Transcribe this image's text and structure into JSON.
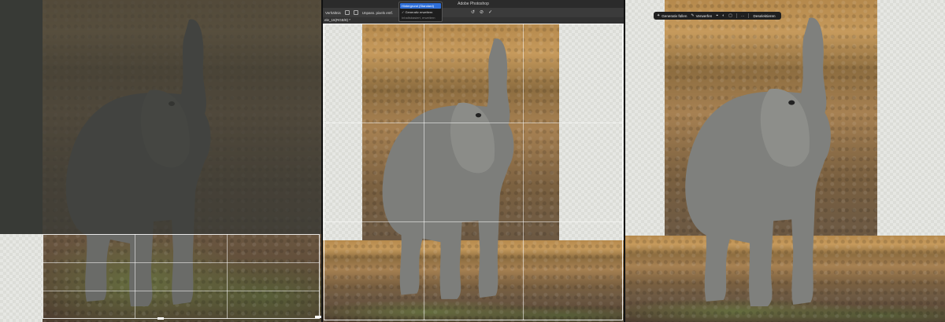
{
  "panel_middle": {
    "app_title": "Adobe Photoshop",
    "options_bar": {
      "ratio_label": "Verhältnis",
      "straighten_label": "Geraderichten",
      "delete_pixels_label": "Unpass. pixels entf."
    },
    "document_tab": "ele_16(RGB/8) *",
    "fill_dropdown": {
      "selected": "Hintergrund (Standard)",
      "items": [
        "✓ Generativ erweitern",
        "Inhaltsbasiert, erweitern"
      ]
    },
    "commit_icons": [
      "reset-icon",
      "cancel-icon",
      "commit-icon"
    ]
  },
  "panel_right": {
    "taskbar": {
      "generative_fill": "Generativ füllen",
      "cancel": "Verwerfen",
      "more": "···",
      "deselect": "Deselektieren"
    }
  },
  "colors": {
    "selection_blue": "#2f6fd8",
    "canvas_transparency": "#e6e7e3",
    "dim_overlay": "#373934"
  }
}
